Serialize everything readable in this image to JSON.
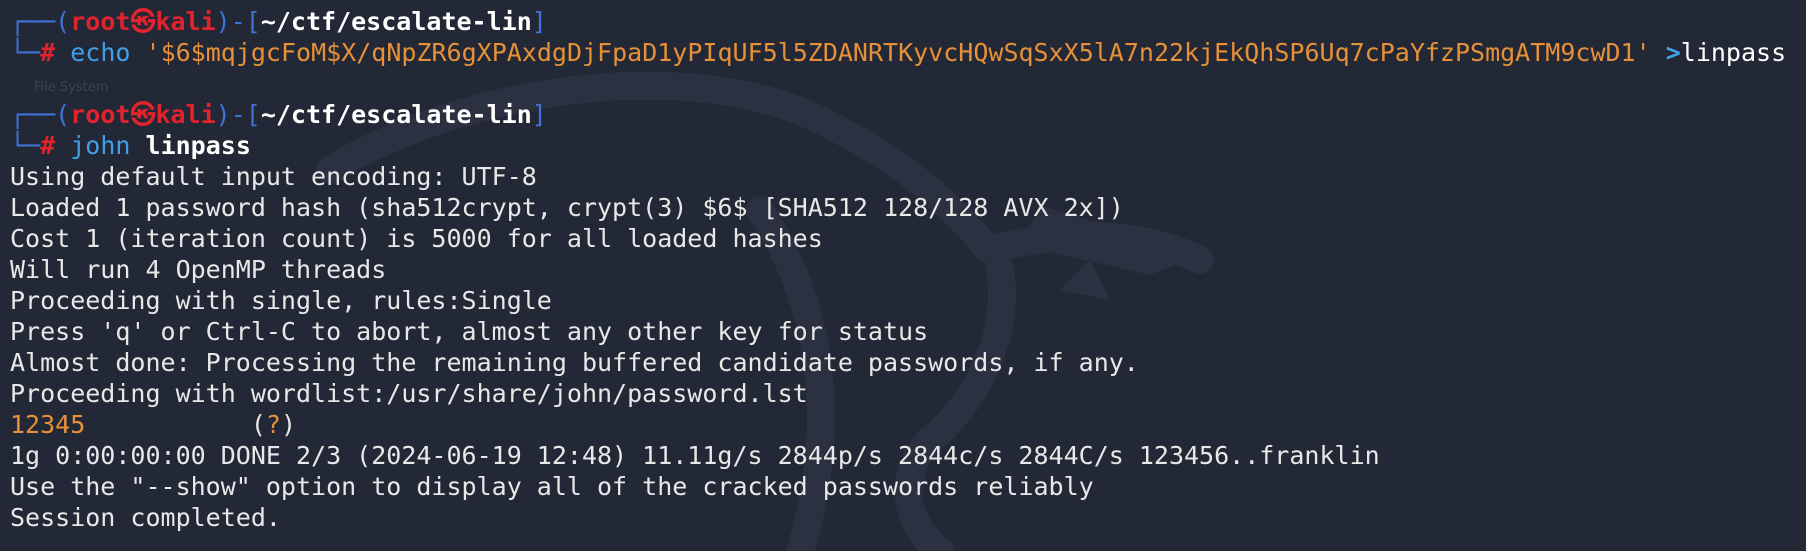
{
  "background_text": "File System",
  "prompt": {
    "open": "┌──(",
    "user": "root",
    "skull": "㉿",
    "host": "kali",
    "mid": ")-[",
    "path": "~/ctf/escalate-lin",
    "close": "]",
    "corner": "└─",
    "hash": "#"
  },
  "commands": [
    {
      "cmd": "echo",
      "string": "'$6$mqjgcFoM$X/qNpZR6gXPAxdgDjFpaD1yPIqUF5l5ZDANRTKyvcHQwSqSxX5lA7n22kjEkQhSP6Uq7cPaYfzPSmgATM9cwD1'",
      "redirect": ">",
      "target": "linpass"
    },
    {
      "cmd": "john",
      "arg": "linpass"
    }
  ],
  "output": [
    "Using default input encoding: UTF-8",
    "Loaded 1 password hash (sha512crypt, crypt(3) $6$ [SHA512 128/128 AVX 2x])",
    "Cost 1 (iteration count) is 5000 for all loaded hashes",
    "Will run 4 OpenMP threads",
    "Proceeding with single, rules:Single",
    "Press 'q' or Ctrl-C to abort, almost any other key for status",
    "Almost done: Processing the remaining buffered candidate passwords, if any.",
    "Proceeding with wordlist:/usr/share/john/password.lst"
  ],
  "cracked": {
    "password": "12345",
    "spacing": "           ",
    "user": "(?)"
  },
  "summary": [
    "1g 0:00:00:00 DONE 2/3 (2024-06-19 12:48) 11.11g/s 2844p/s 2844c/s 2844C/s 123456..franklin",
    "Use the \"--show\" option to display all of the cracked passwords reliably",
    "Session completed."
  ],
  "colors": {
    "background": "#232836",
    "frame": "#3f73d6",
    "root": "#e1232e",
    "command": "#3fa0e8",
    "string": "#e69138"
  }
}
